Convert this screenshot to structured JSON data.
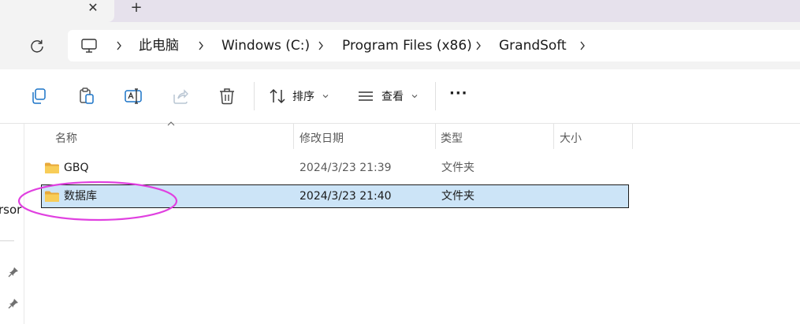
{
  "tabs": {
    "close_label": "✕",
    "add_label": "+"
  },
  "breadcrumb": {
    "items": [
      "此电脑",
      "Windows (C:)",
      "Program Files (x86)",
      "GrandSoft"
    ]
  },
  "toolbar": {
    "sort_label": "排序",
    "view_label": "查看",
    "more_label": "···"
  },
  "nav": {
    "partial_text": "rsor"
  },
  "columns": {
    "name": "名称",
    "modified": "修改日期",
    "type": "类型",
    "size": "大小"
  },
  "files": [
    {
      "name": "GBQ",
      "modified": "2024/3/23 21:39",
      "type": "文件夹",
      "size": ""
    },
    {
      "name": "数据库",
      "modified": "2024/3/23 21:40",
      "type": "文件夹",
      "size": ""
    }
  ],
  "selected_file_index": 1,
  "colors": {
    "accent_selected": "#cce4f7",
    "folder": "#f6c54a",
    "annotation": "#e040e0"
  },
  "icons": {
    "pc": "computer-monitor-icon",
    "refresh": "refresh-icon",
    "copy": "copy-icon",
    "paste": "paste-icon",
    "rename": "rename-icon",
    "share": "share-icon",
    "delete": "trash-icon",
    "sort": "sort-arrows-icon",
    "view": "view-lines-icon",
    "folder": "folder-icon",
    "pin": "pin-icon"
  }
}
